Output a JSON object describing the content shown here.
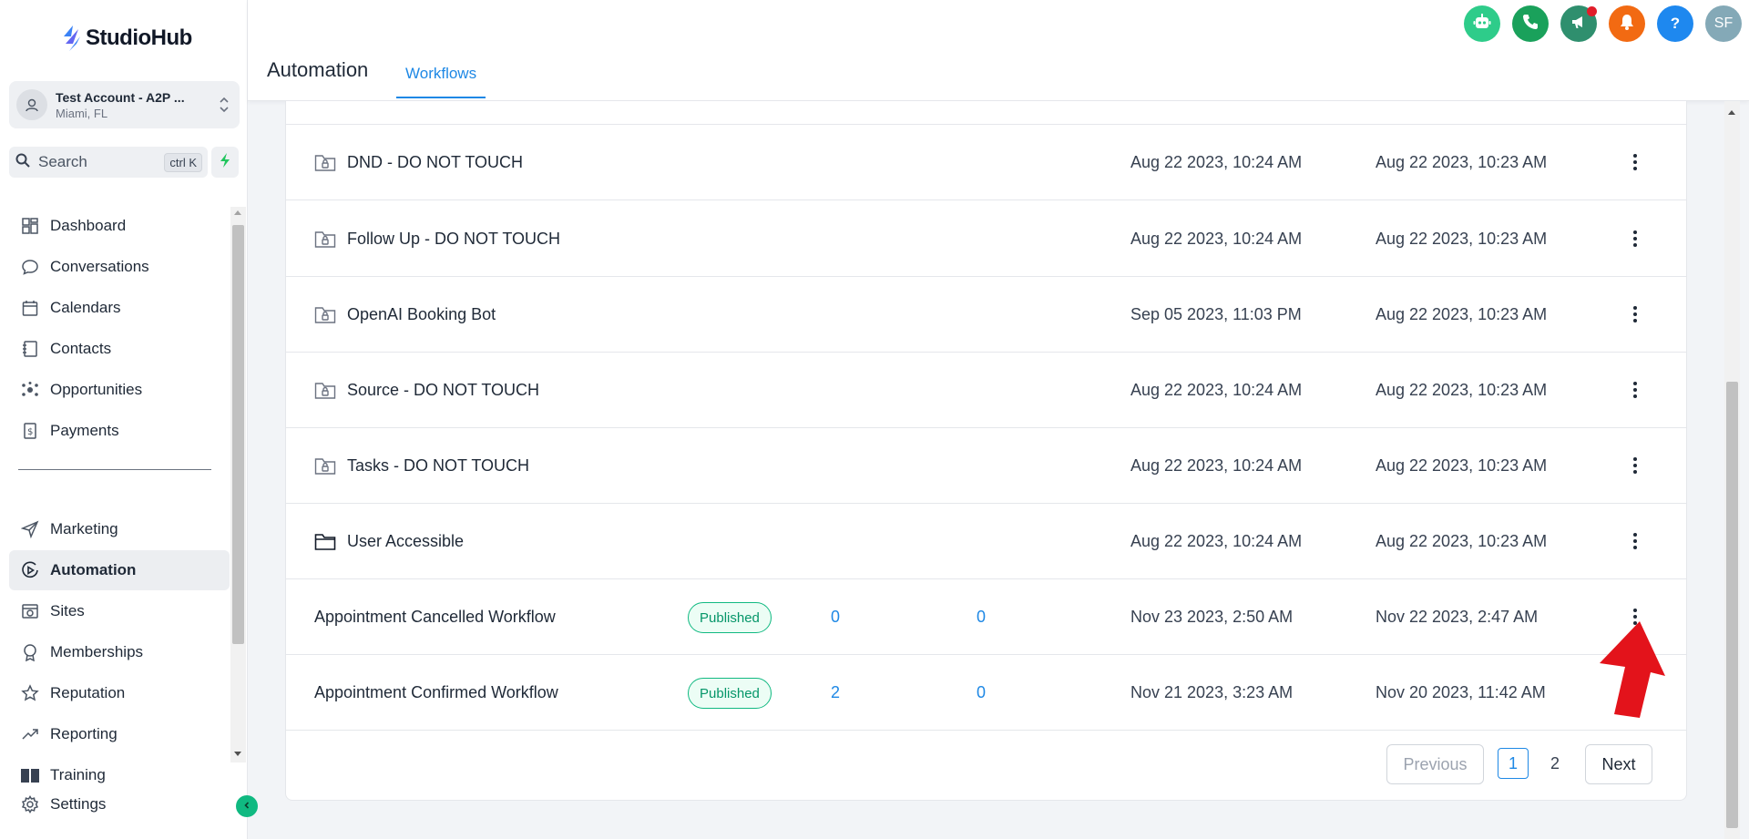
{
  "brand": {
    "name": "StudioHub"
  },
  "account": {
    "name": "Test Account - A2P ...",
    "location": "Miami, FL"
  },
  "search": {
    "label": "Search",
    "shortcut": "ctrl K"
  },
  "nav": {
    "items": [
      {
        "label": "Dashboard",
        "icon": "dashboard-icon"
      },
      {
        "label": "Conversations",
        "icon": "chat-icon"
      },
      {
        "label": "Calendars",
        "icon": "calendar-icon"
      },
      {
        "label": "Contacts",
        "icon": "contacts-icon"
      },
      {
        "label": "Opportunities",
        "icon": "opportunities-icon"
      },
      {
        "label": "Payments",
        "icon": "payments-icon"
      },
      {
        "label": "Marketing",
        "icon": "send-icon"
      },
      {
        "label": "Automation",
        "icon": "automation-icon",
        "active": true
      },
      {
        "label": "Sites",
        "icon": "sites-icon"
      },
      {
        "label": "Memberships",
        "icon": "memberships-icon"
      },
      {
        "label": "Reputation",
        "icon": "star-icon"
      },
      {
        "label": "Reporting",
        "icon": "trend-icon"
      },
      {
        "label": "Training",
        "icon": "book-icon"
      }
    ],
    "settings_label": "Settings"
  },
  "header": {
    "title": "Automation",
    "tab": "Workflows",
    "avatar_initials": "SF",
    "help_label": "?"
  },
  "colors": {
    "accent": "#1e88e5",
    "published_green": "#059669",
    "bot_btn": "#2ecc8a",
    "phone_btn": "#1aa15b",
    "megaphone_btn": "#2f8f6e",
    "bell_btn": "#f26a12",
    "help_btn": "#1e88ef",
    "avatar_btn": "#84a9b7"
  },
  "rows": [
    {
      "name": "DND - DO NOT TOUCH",
      "type": "locked-folder",
      "updated": "Aug 22 2023, 10:24 AM",
      "created": "Aug 22 2023, 10:23 AM"
    },
    {
      "name": "Follow Up - DO NOT TOUCH",
      "type": "locked-folder",
      "updated": "Aug 22 2023, 10:24 AM",
      "created": "Aug 22 2023, 10:23 AM"
    },
    {
      "name": "OpenAI Booking Bot",
      "type": "locked-folder",
      "updated": "Sep 05 2023, 11:03 PM",
      "created": "Aug 22 2023, 10:23 AM"
    },
    {
      "name": "Source - DO NOT TOUCH",
      "type": "locked-folder",
      "updated": "Aug 22 2023, 10:24 AM",
      "created": "Aug 22 2023, 10:23 AM"
    },
    {
      "name": "Tasks - DO NOT TOUCH",
      "type": "locked-folder",
      "updated": "Aug 22 2023, 10:24 AM",
      "created": "Aug 22 2023, 10:23 AM"
    },
    {
      "name": "User Accessible",
      "type": "folder",
      "updated": "Aug 22 2023, 10:24 AM",
      "created": "Aug 22 2023, 10:23 AM"
    },
    {
      "name": "Appointment Cancelled Workflow",
      "type": "workflow",
      "status": "Published",
      "total": "0",
      "active": "0",
      "updated": "Nov 23 2023, 2:50 AM",
      "created": "Nov 22 2023, 2:47 AM"
    },
    {
      "name": "Appointment Confirmed Workflow",
      "type": "workflow",
      "status": "Published",
      "total": "2",
      "active": "0",
      "updated": "Nov 21 2023, 3:23 AM",
      "created": "Nov 20 2023, 11:42 AM"
    }
  ],
  "pagination": {
    "previous": "Previous",
    "next": "Next",
    "pages": [
      "1",
      "2"
    ],
    "current": "1"
  }
}
